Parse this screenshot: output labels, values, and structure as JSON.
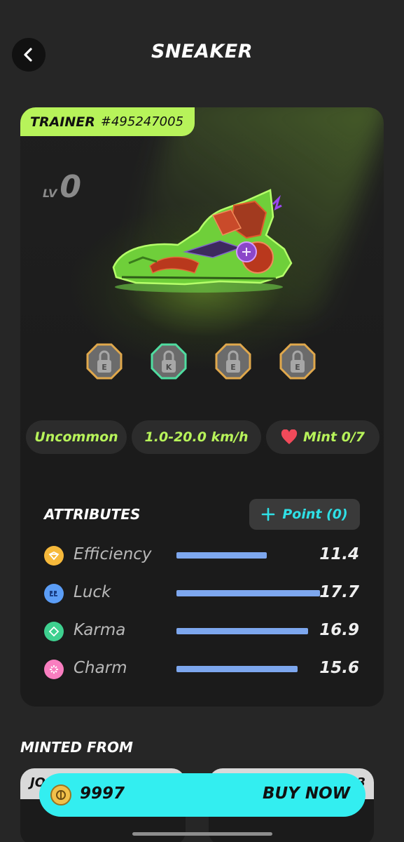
{
  "header": {
    "title": "SNEAKER"
  },
  "card": {
    "trainer_type": "TRAINER",
    "trainer_id": "#495247005",
    "level_label": "LV",
    "level_value": "0",
    "sockets": [
      {
        "letter": "E",
        "color": "#e0a84c"
      },
      {
        "letter": "K",
        "color": "#4fdda0"
      },
      {
        "letter": "E",
        "color": "#e0a84c"
      },
      {
        "letter": "E",
        "color": "#e0a84c"
      }
    ],
    "tags": {
      "rarity": "Uncommon",
      "speed": "1.0-20.0 km/h",
      "mint": "Mint 0/7"
    }
  },
  "attributes": {
    "title": "ATTRIBUTES",
    "point_button": "Point (0)",
    "items": [
      {
        "name": "Efficiency",
        "value": "11.4",
        "fill": 0.63,
        "icon_color": "#f6b93b",
        "icon": "efficiency-icon"
      },
      {
        "name": "Luck",
        "value": "17.7",
        "fill": 1.0,
        "icon_color": "#5b9df6",
        "icon": "luck-icon"
      },
      {
        "name": "Karma",
        "value": "16.9",
        "fill": 0.915,
        "icon_color": "#3ed08f",
        "icon": "karma-icon"
      },
      {
        "name": "Charm",
        "value": "15.6",
        "fill": 0.845,
        "icon_color": "#f97ec0",
        "icon": "charm-icon"
      }
    ]
  },
  "minted_from": {
    "title": "MINTED FROM",
    "cards": [
      {
        "label": "JO"
      },
      {
        "label": "3"
      }
    ]
  },
  "buy": {
    "price": "9997",
    "label": "BUY NOW"
  },
  "colors": {
    "accent_green": "#b7f35a",
    "accent_cyan": "#33eef0",
    "bar_blue": "#7da7ee"
  }
}
